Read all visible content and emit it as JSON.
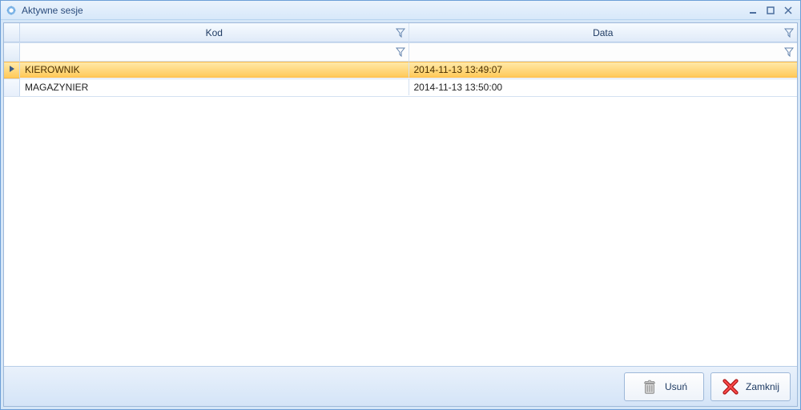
{
  "window": {
    "title": "Aktywne sesje"
  },
  "grid": {
    "columns": [
      {
        "label": "Kod"
      },
      {
        "label": "Data"
      }
    ],
    "rows": [
      {
        "kod": "KIEROWNIK",
        "data": "2014-11-13 13:49:07",
        "selected": true
      },
      {
        "kod": "MAGAZYNIER",
        "data": "2014-11-13 13:50:00",
        "selected": false
      }
    ]
  },
  "buttons": {
    "delete": "Usuń",
    "close": "Zamknij"
  }
}
